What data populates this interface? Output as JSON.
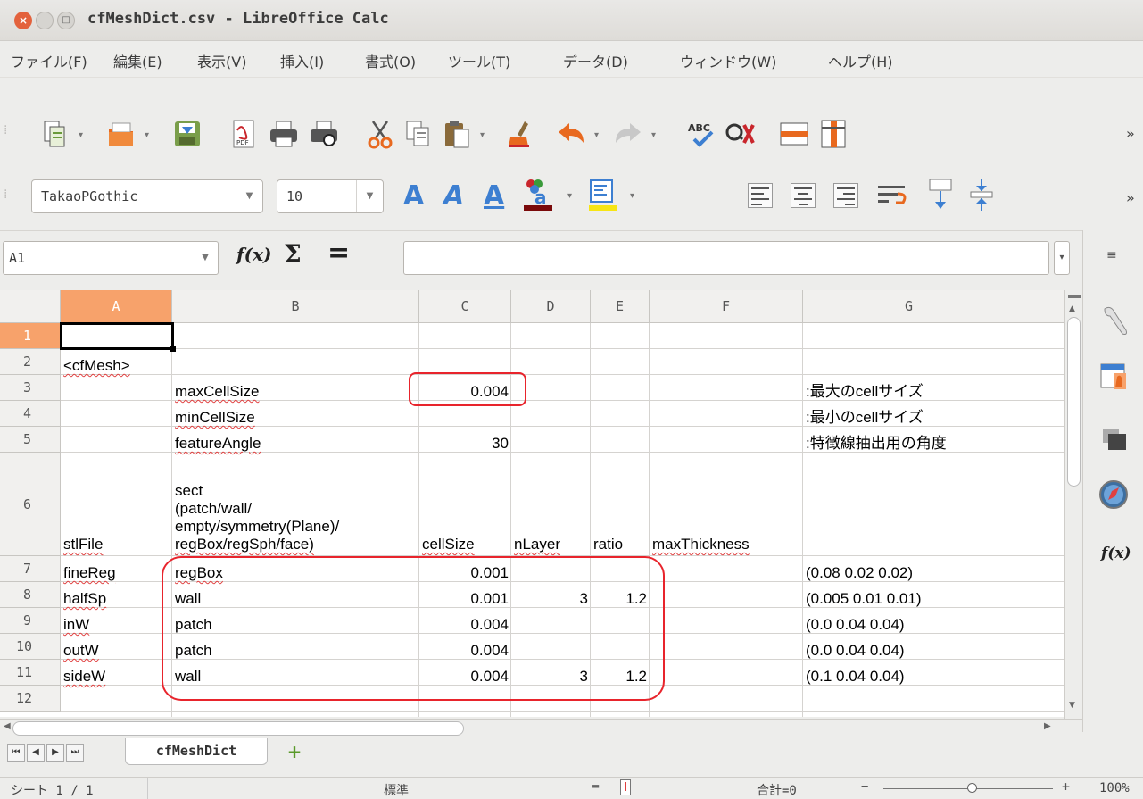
{
  "window": {
    "title": "cfMeshDict.csv - LibreOffice Calc"
  },
  "menu": [
    "ファイル(F)",
    "編集(E)",
    "表示(V)",
    "挿入(I)",
    "書式(O)",
    "ツール(T)",
    "データ(D)",
    "ウィンドウ(W)",
    "ヘルプ(H)"
  ],
  "formatting": {
    "font_name": "TakaoPGothic",
    "font_size": "10"
  },
  "formula_bar": {
    "cell_ref": "A1",
    "function_wizard": "f(x)",
    "sum": "Σ",
    "equals": "=",
    "content": ""
  },
  "toolbar": {
    "more": "»",
    "abc": "ABC"
  },
  "columns": [
    "A",
    "B",
    "C",
    "D",
    "E",
    "F",
    "G"
  ],
  "rows": [
    "1",
    "2",
    "3",
    "4",
    "5",
    "6",
    "7",
    "8",
    "9",
    "10",
    "11",
    "12"
  ],
  "cells": {
    "A2": "<cfMesh>",
    "B3": "maxCellSize",
    "C3": "0.004",
    "G3": ":最大のcellサイズ",
    "B4": "minCellSize",
    "G4": ":最小のcellサイズ",
    "B5": "featureAngle",
    "C5": "30",
    "G5": ":特徴線抽出用の角度",
    "A6": "stlFile",
    "B6_lines": [
      "sect",
      "(patch/wall/",
      "empty/symmetry(Plane)/",
      "regBox/regSph/face)"
    ],
    "C6": "cellSize",
    "D6": "nLayer",
    "E6": "ratio",
    "F6": "maxThickness",
    "A7": "fineReg",
    "B7": "regBox",
    "C7": "0.001",
    "G7": "(0.08 0.02 0.02)",
    "A8": "halfSp",
    "B8": "wall",
    "C8": "0.001",
    "D8": "3",
    "E8": "1.2",
    "G8": "(0.005 0.01 0.01)",
    "A9": "inW",
    "B9": "patch",
    "C9": "0.004",
    "G9": "(0.0 0.04 0.04)",
    "A10": "outW",
    "B10": "patch",
    "C10": "0.004",
    "G10": "(0.0 0.04 0.04)",
    "A11": "sideW",
    "B11": "wall",
    "C11": "0.004",
    "D11": "3",
    "E11": "1.2",
    "G11": "(0.1 0.04 0.04)"
  },
  "sheet_tab": "cfMeshDict",
  "status": {
    "sheet": "シート 1 / 1",
    "style": "標準",
    "sum": "合計=0",
    "zoom": "100%"
  },
  "colors": {
    "accent": "#f7a26b",
    "highlight_box": "#e8242c",
    "formula_icon": "#3d7fd1"
  }
}
